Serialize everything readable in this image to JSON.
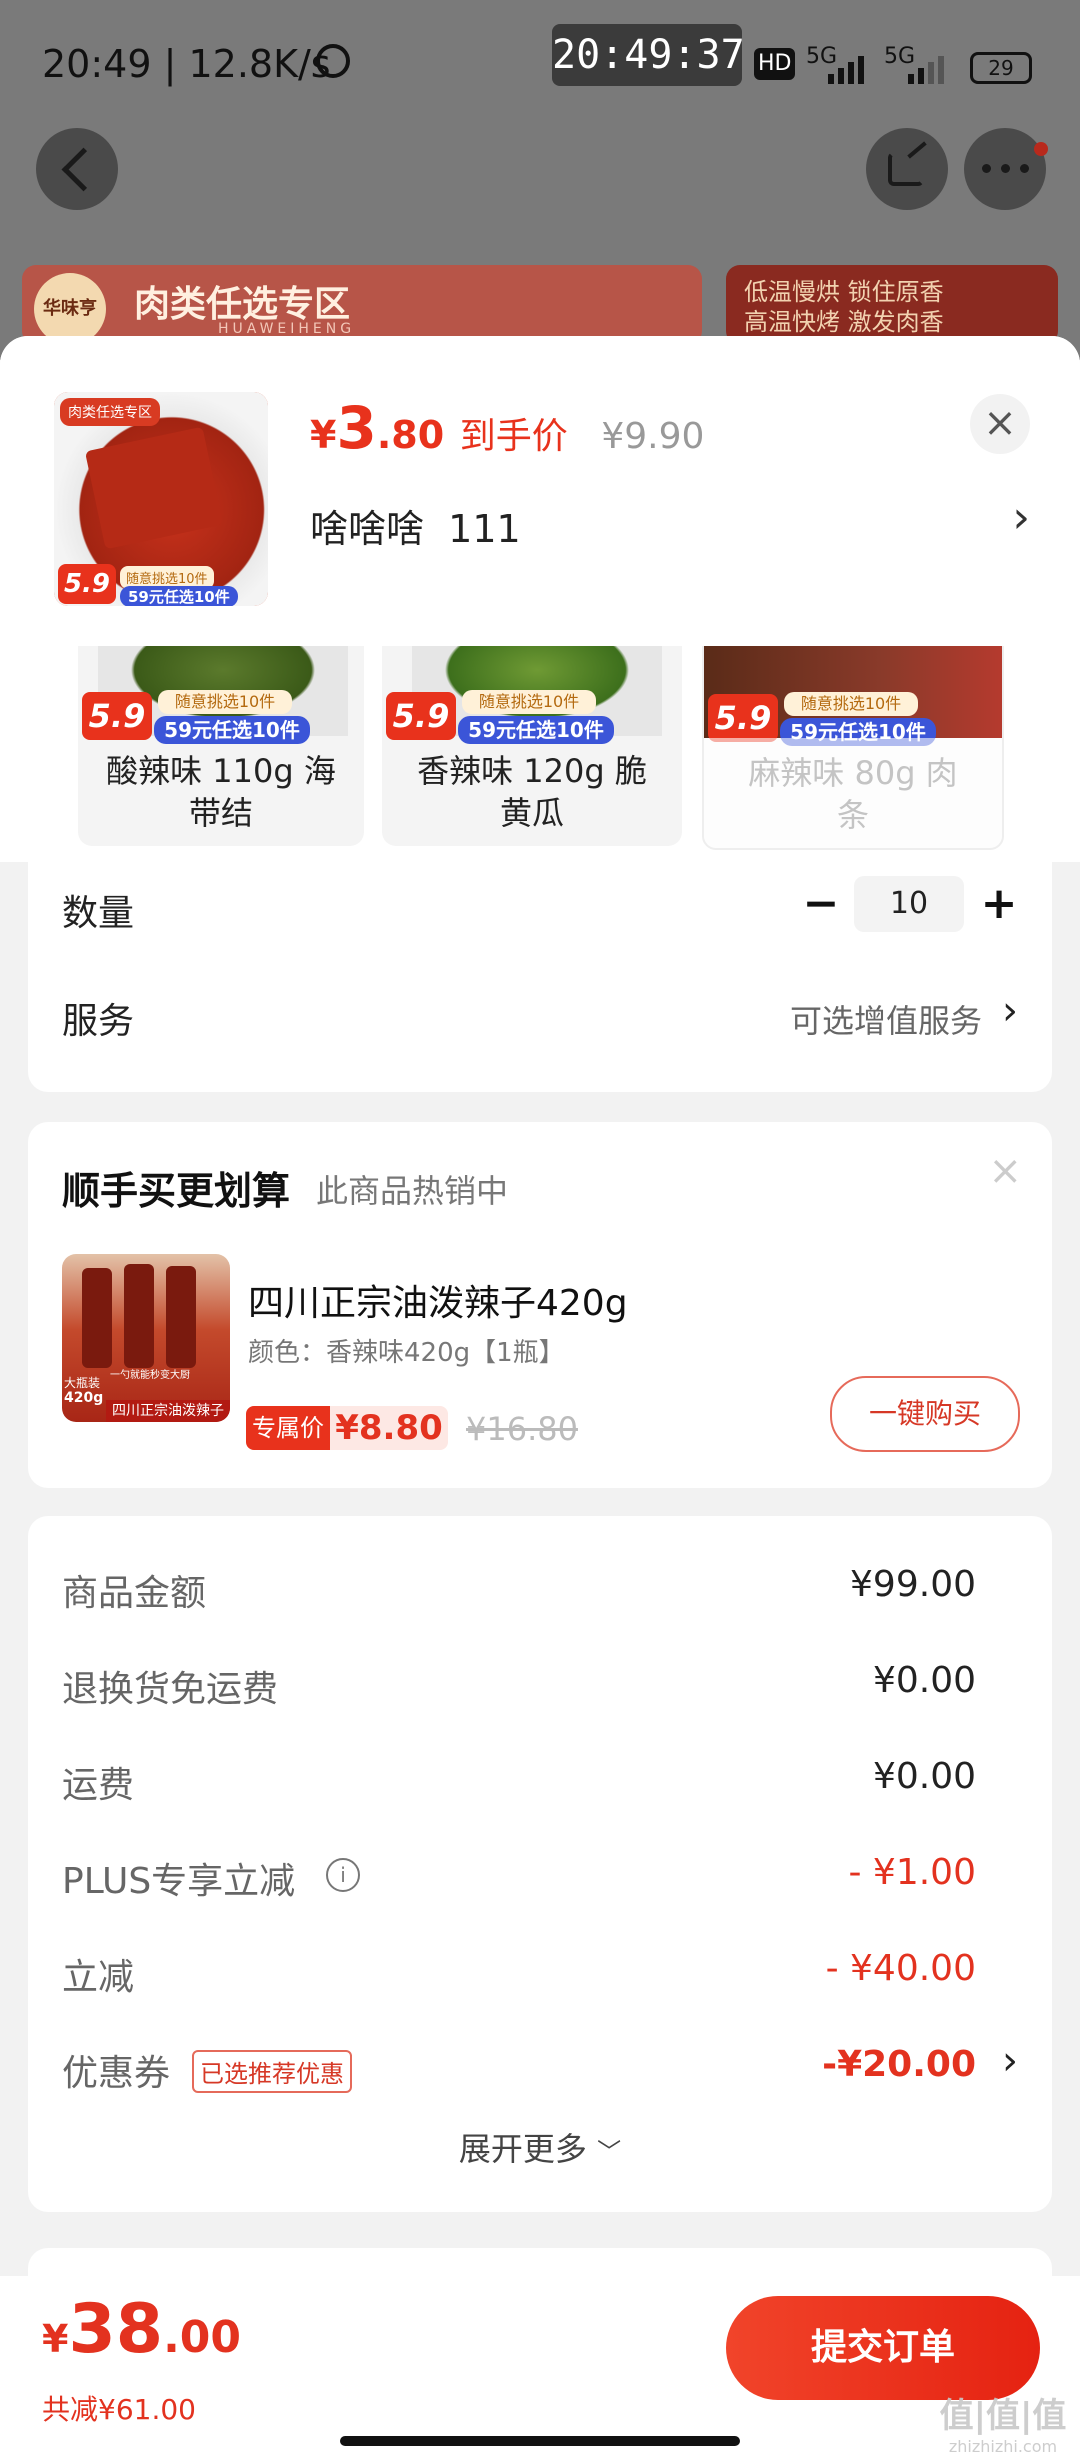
{
  "status_bar": {
    "time": "20:49 | 12.8K/s",
    "clock_overlay": "20:49:37",
    "hd": "HD",
    "net1": "5G",
    "net2": "5G",
    "battery": "29"
  },
  "background": {
    "banner_left_text": "肉类任选专区",
    "banner_left_sub": "HUAWEIHENG",
    "banner_left_logo": "华味亨",
    "banner_right_line1": "低温慢烘 锁住原香",
    "banner_right_line2": "高温快烤 激发肉香"
  },
  "product": {
    "thumb_label": "肉类任选专区",
    "thumb_badge": "5.9",
    "thumb_badge_note": "随意挑选10件",
    "thumb_badge_blue": "59元任选10件",
    "price_symbol": "¥",
    "price_int": "3",
    "price_dec": ".80",
    "price_tag": "到手价",
    "orig_price": "¥9.90",
    "spec": "啥啥啥  111",
    "close": "×",
    "chevron": "›"
  },
  "variants": [
    {
      "name": "酸辣味 110g 海带结",
      "line1": "酸辣味 110g 海",
      "line2": "带结",
      "badge": "5.9",
      "note": "随意挑选10件",
      "blue": "59元任选10件",
      "disabled": false
    },
    {
      "name": "香辣味 120g 脆黄瓜",
      "line1": "香辣味 120g 脆",
      "line2": "黄瓜",
      "badge": "5.9",
      "note": "随意挑选10件",
      "blue": "59元任选10件",
      "disabled": false
    },
    {
      "name": "麻辣味 80g 肉条",
      "line1": "麻辣味 80g 肉",
      "line2": "条",
      "badge": "5.9",
      "note": "随意挑选10件",
      "blue": "59元任选10件",
      "disabled": true
    }
  ],
  "quantity": {
    "label": "数量",
    "value": "10",
    "minus": "−",
    "plus": "+"
  },
  "service": {
    "label": "服务",
    "value": "可选增值服务",
    "chevron": "›"
  },
  "addon": {
    "title": "顺手买更划算",
    "subtitle": "此商品热销中",
    "close": "×",
    "name": "四川正宗油泼辣子420g",
    "color": "颜色：香辣味420g【1瓶】",
    "tag": "专属价",
    "price": "¥8.80",
    "orig": "¥16.80",
    "buy": "一键购买",
    "img_big": "大瓶装",
    "img_weight": "420g",
    "img_caption": "四川正宗油泼辣子",
    "img_slogan": "一勺就能秒变大厨"
  },
  "summary": {
    "rows": [
      {
        "label": "商品金额",
        "value": "¥99.00",
        "red": false
      },
      {
        "label": "退换货免运费",
        "value": "¥0.00",
        "red": false
      },
      {
        "label": "运费",
        "value": "¥0.00",
        "red": false
      },
      {
        "label": "PLUS专享立减",
        "value": "- ¥1.00",
        "red": true
      },
      {
        "label": "立减",
        "value": "- ¥40.00",
        "red": true
      },
      {
        "label": "优惠券",
        "value": "-¥20.00",
        "red": true
      }
    ],
    "coupon_tag": "已选推荐优惠",
    "info_icon": "i",
    "expand": "展开更多",
    "expand_icon": "﹀"
  },
  "footer": {
    "total_symbol": "¥",
    "total_int": "38",
    "total_dec": ".00",
    "saved": "共减¥61.00",
    "submit": "提交订单",
    "watermark": "值|值|值",
    "watermark_sub": "zhizhizhi.com"
  },
  "colors": {
    "accent": "#e3321f",
    "blue_badge": "#3b55d8"
  }
}
